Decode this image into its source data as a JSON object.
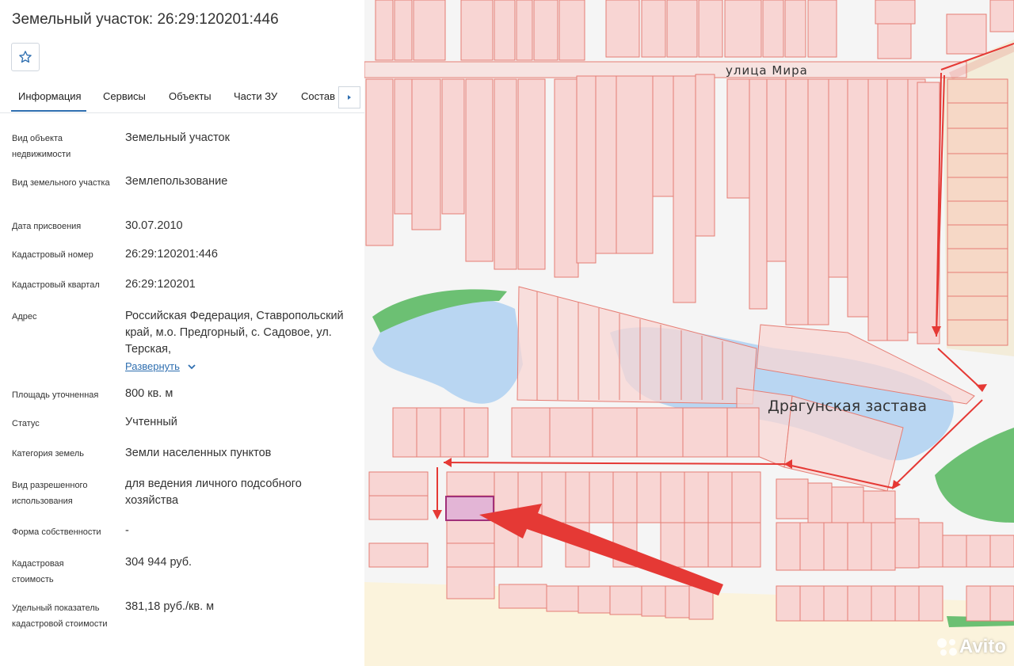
{
  "page": {
    "title": "Земельный участок: 26:29:120201:446"
  },
  "tabs": [
    {
      "label": "Информация",
      "active": true
    },
    {
      "label": "Сервисы"
    },
    {
      "label": "Объекты"
    },
    {
      "label": "Части ЗУ"
    },
    {
      "label": "Состав"
    }
  ],
  "info": {
    "object_type": {
      "label": "Вид объекта недвижимости",
      "value": "Земельный участок"
    },
    "land_type": {
      "label": "Вид земельного участка",
      "value": "Землепользование"
    },
    "assigned_date": {
      "label": "Дата присвоения",
      "value": "30.07.2010"
    },
    "cadastral_number": {
      "label": "Кадастровый номер",
      "value": "26:29:120201:446"
    },
    "cadastral_quarter": {
      "label": "Кадастровый квартал",
      "value": "26:29:120201"
    },
    "address": {
      "label": "Адрес",
      "value": "Российская Федерация, Ставропольский край, м.о. Предгорный, с. Садовое, ул. Терская,",
      "expand_label": "Развернуть"
    },
    "area": {
      "label": "Площадь уточненная",
      "value": "800 кв. м"
    },
    "status": {
      "label": "Статус",
      "value": "Учтенный"
    },
    "land_category": {
      "label": "Категория земель",
      "value": "Земли населенных пунктов"
    },
    "permitted_use": {
      "label": "Вид разрешенного использования",
      "value": "для ведения личного подсобного хозяйства"
    },
    "ownership_form": {
      "label": "Форма собственности",
      "value": "-"
    },
    "cadastral_value": {
      "label": "Кадастровая стоимость",
      "value": "304 944 руб."
    },
    "specific_value": {
      "label": "Удельный показатель кадастровой стоимости",
      "value": "381,18 руб./кв. м"
    }
  },
  "map": {
    "street_label": "улица Мира",
    "area_label": "Драгунская застава",
    "watermark": "Avito"
  },
  "colors": {
    "accent": "#2f6fb0",
    "parcel_fill": "#f8d5d3",
    "parcel_stroke": "#e57d74",
    "water": "#b9d6f2",
    "green": "#6cc073",
    "arrow": "#e53935",
    "selected_parcel": "#a0307a"
  },
  "icons": {
    "favorite": "star-icon",
    "tabs_next": "chevron-right-icon",
    "expand": "chevron-down-icon"
  }
}
